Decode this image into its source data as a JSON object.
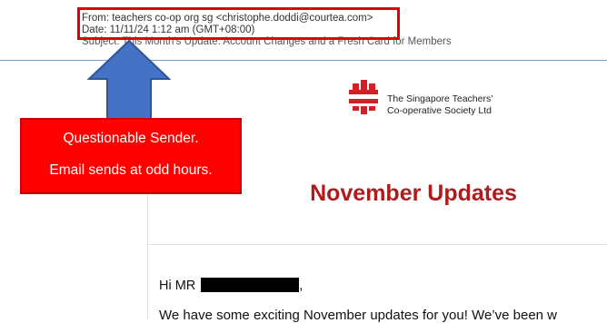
{
  "email_header": {
    "from": "From: teachers co-op org sg <christophe.doddi@courtea.com>",
    "date": "Date: 11/11/24 1:12 am (GMT+08:00)",
    "subject": "Subject: This Month's Update: Account Changes and a Fresh Card for Members"
  },
  "email_body": {
    "logo_line1": "The Singapore Teachers’",
    "logo_line2": "Co-operative Society Ltd",
    "title": "November Updates",
    "greeting": "Hi MR",
    "greeting_punct": ",",
    "teaser": "We have some exciting November updates for you! We’ve been w"
  },
  "annotation": {
    "line1": "Questionable Sender.",
    "line2": "Email sends at odd hours."
  },
  "colors": {
    "accent_red": "#ff0000",
    "title_red": "#b01b1b",
    "arrow_blue": "#4472c4",
    "logo_red": "#d51f26"
  }
}
